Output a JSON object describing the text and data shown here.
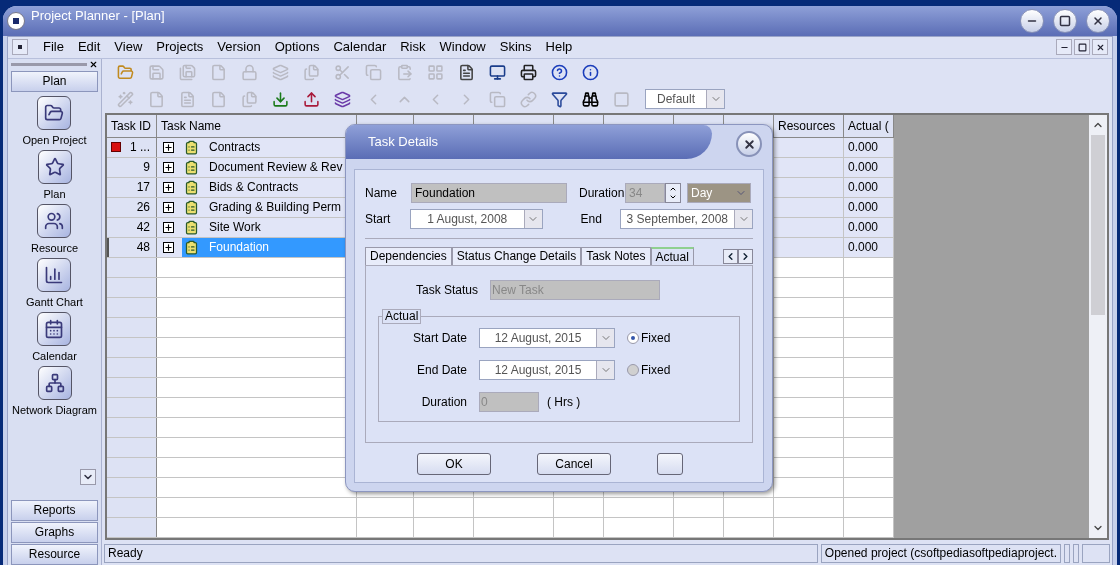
{
  "window": {
    "title": "Project Planner - [Plan]"
  },
  "menu": [
    "File",
    "Edit",
    "View",
    "Projects",
    "Version",
    "Options",
    "Calendar",
    "Risk",
    "Window",
    "Skins",
    "Help"
  ],
  "toolbar_1": [
    {
      "kind": "open",
      "disabled": false
    },
    {
      "kind": "save",
      "disabled": true
    },
    {
      "kind": "save-all",
      "disabled": true
    },
    {
      "kind": "file",
      "disabled": true
    },
    {
      "kind": "lock",
      "disabled": true
    },
    {
      "kind": "layers",
      "disabled": true
    },
    {
      "kind": "copy-file",
      "disabled": true
    },
    {
      "kind": "cut",
      "disabled": true
    },
    {
      "kind": "copy",
      "disabled": true
    },
    {
      "kind": "paste",
      "disabled": true
    },
    {
      "kind": "grid",
      "disabled": true
    },
    {
      "kind": "page",
      "disabled": false
    },
    {
      "kind": "preview",
      "disabled": false
    },
    {
      "kind": "print",
      "disabled": false
    },
    {
      "kind": "help",
      "disabled": false
    },
    {
      "kind": "info",
      "disabled": false
    }
  ],
  "toolbar_2": [
    {
      "kind": "wand",
      "disabled": true
    },
    {
      "kind": "file",
      "disabled": true
    },
    {
      "kind": "page",
      "disabled": true
    },
    {
      "kind": "file",
      "disabled": true
    },
    {
      "kind": "copy-file",
      "disabled": true
    },
    {
      "kind": "import",
      "disabled": false
    },
    {
      "kind": "export",
      "disabled": false
    },
    {
      "kind": "layers",
      "disabled": false
    },
    {
      "kind": "left",
      "disabled": true
    },
    {
      "kind": "up",
      "disabled": true
    },
    {
      "kind": "left",
      "disabled": true
    },
    {
      "kind": "right",
      "disabled": true
    },
    {
      "kind": "copy",
      "disabled": true
    },
    {
      "kind": "link",
      "disabled": true
    },
    {
      "kind": "filter",
      "disabled": false
    },
    {
      "kind": "binoculars",
      "disabled": false
    },
    {
      "kind": "square",
      "disabled": true
    }
  ],
  "view_combo": {
    "value": "Default"
  },
  "sidebar": {
    "header": "Plan",
    "items": [
      {
        "kind": "open",
        "label": "Open Project"
      },
      {
        "kind": "plan",
        "label": "Plan"
      },
      {
        "kind": "resource",
        "label": "Resource"
      },
      {
        "kind": "gantt",
        "label": "Gantt Chart"
      },
      {
        "kind": "calendar",
        "label": "Calendar"
      },
      {
        "kind": "network",
        "label": "Network Diagram"
      }
    ],
    "sections": [
      "Reports",
      "Graphs",
      "Resource"
    ]
  },
  "table": {
    "columns": [
      "Task ID",
      "Task Name",
      "Resources",
      "Actual ("
    ],
    "rows": [
      {
        "id": "1 ...",
        "flag": true,
        "name": "Contracts",
        "actual": "0.000",
        "selected": false
      },
      {
        "id": "9",
        "flag": false,
        "name": "Document Review & Rev",
        "actual": "0.000",
        "selected": false
      },
      {
        "id": "17",
        "flag": false,
        "name": "Bids & Contracts",
        "actual": "0.000",
        "selected": false
      },
      {
        "id": "26",
        "flag": false,
        "name": "Grading & Building Perm",
        "actual": "0.000",
        "selected": false
      },
      {
        "id": "42",
        "flag": false,
        "name": "Site Work",
        "actual": "0.000",
        "selected": false
      },
      {
        "id": "48",
        "flag": false,
        "name": "Foundation",
        "actual": "0.000",
        "selected": true
      }
    ]
  },
  "status_bar": [
    "Ready",
    "Opened project (csoftpediasoftpediaproject."
  ],
  "dialog": {
    "title": "Task Details",
    "name": {
      "label": "Name",
      "value": "Foundation"
    },
    "duration": {
      "label": "Duration",
      "value": "34",
      "unit": "Day"
    },
    "start": {
      "label": "Start",
      "value": "1 August, 2008"
    },
    "end": {
      "label": "End",
      "value": "3 September, 2008"
    },
    "tabs": [
      {
        "label": "Dependencies",
        "selected": false
      },
      {
        "label": "Status Change Details",
        "selected": false
      },
      {
        "label": "Task Notes",
        "selected": false
      },
      {
        "label": "Actual",
        "selected": true
      }
    ],
    "task_status": {
      "label": "Task Status",
      "value": "New Task"
    },
    "group": "Actual",
    "actual_start": {
      "label": "Start Date",
      "value": "12 August, 2015",
      "fixed_label": "Fixed",
      "selected": true
    },
    "actual_end": {
      "label": "End Date",
      "value": "12 August, 2015",
      "fixed_label": "Fixed",
      "selected": false
    },
    "actual_duration": {
      "label": "Duration",
      "value": "0",
      "unit": "( Hrs )"
    },
    "buttons": [
      "OK",
      "Cancel"
    ]
  }
}
